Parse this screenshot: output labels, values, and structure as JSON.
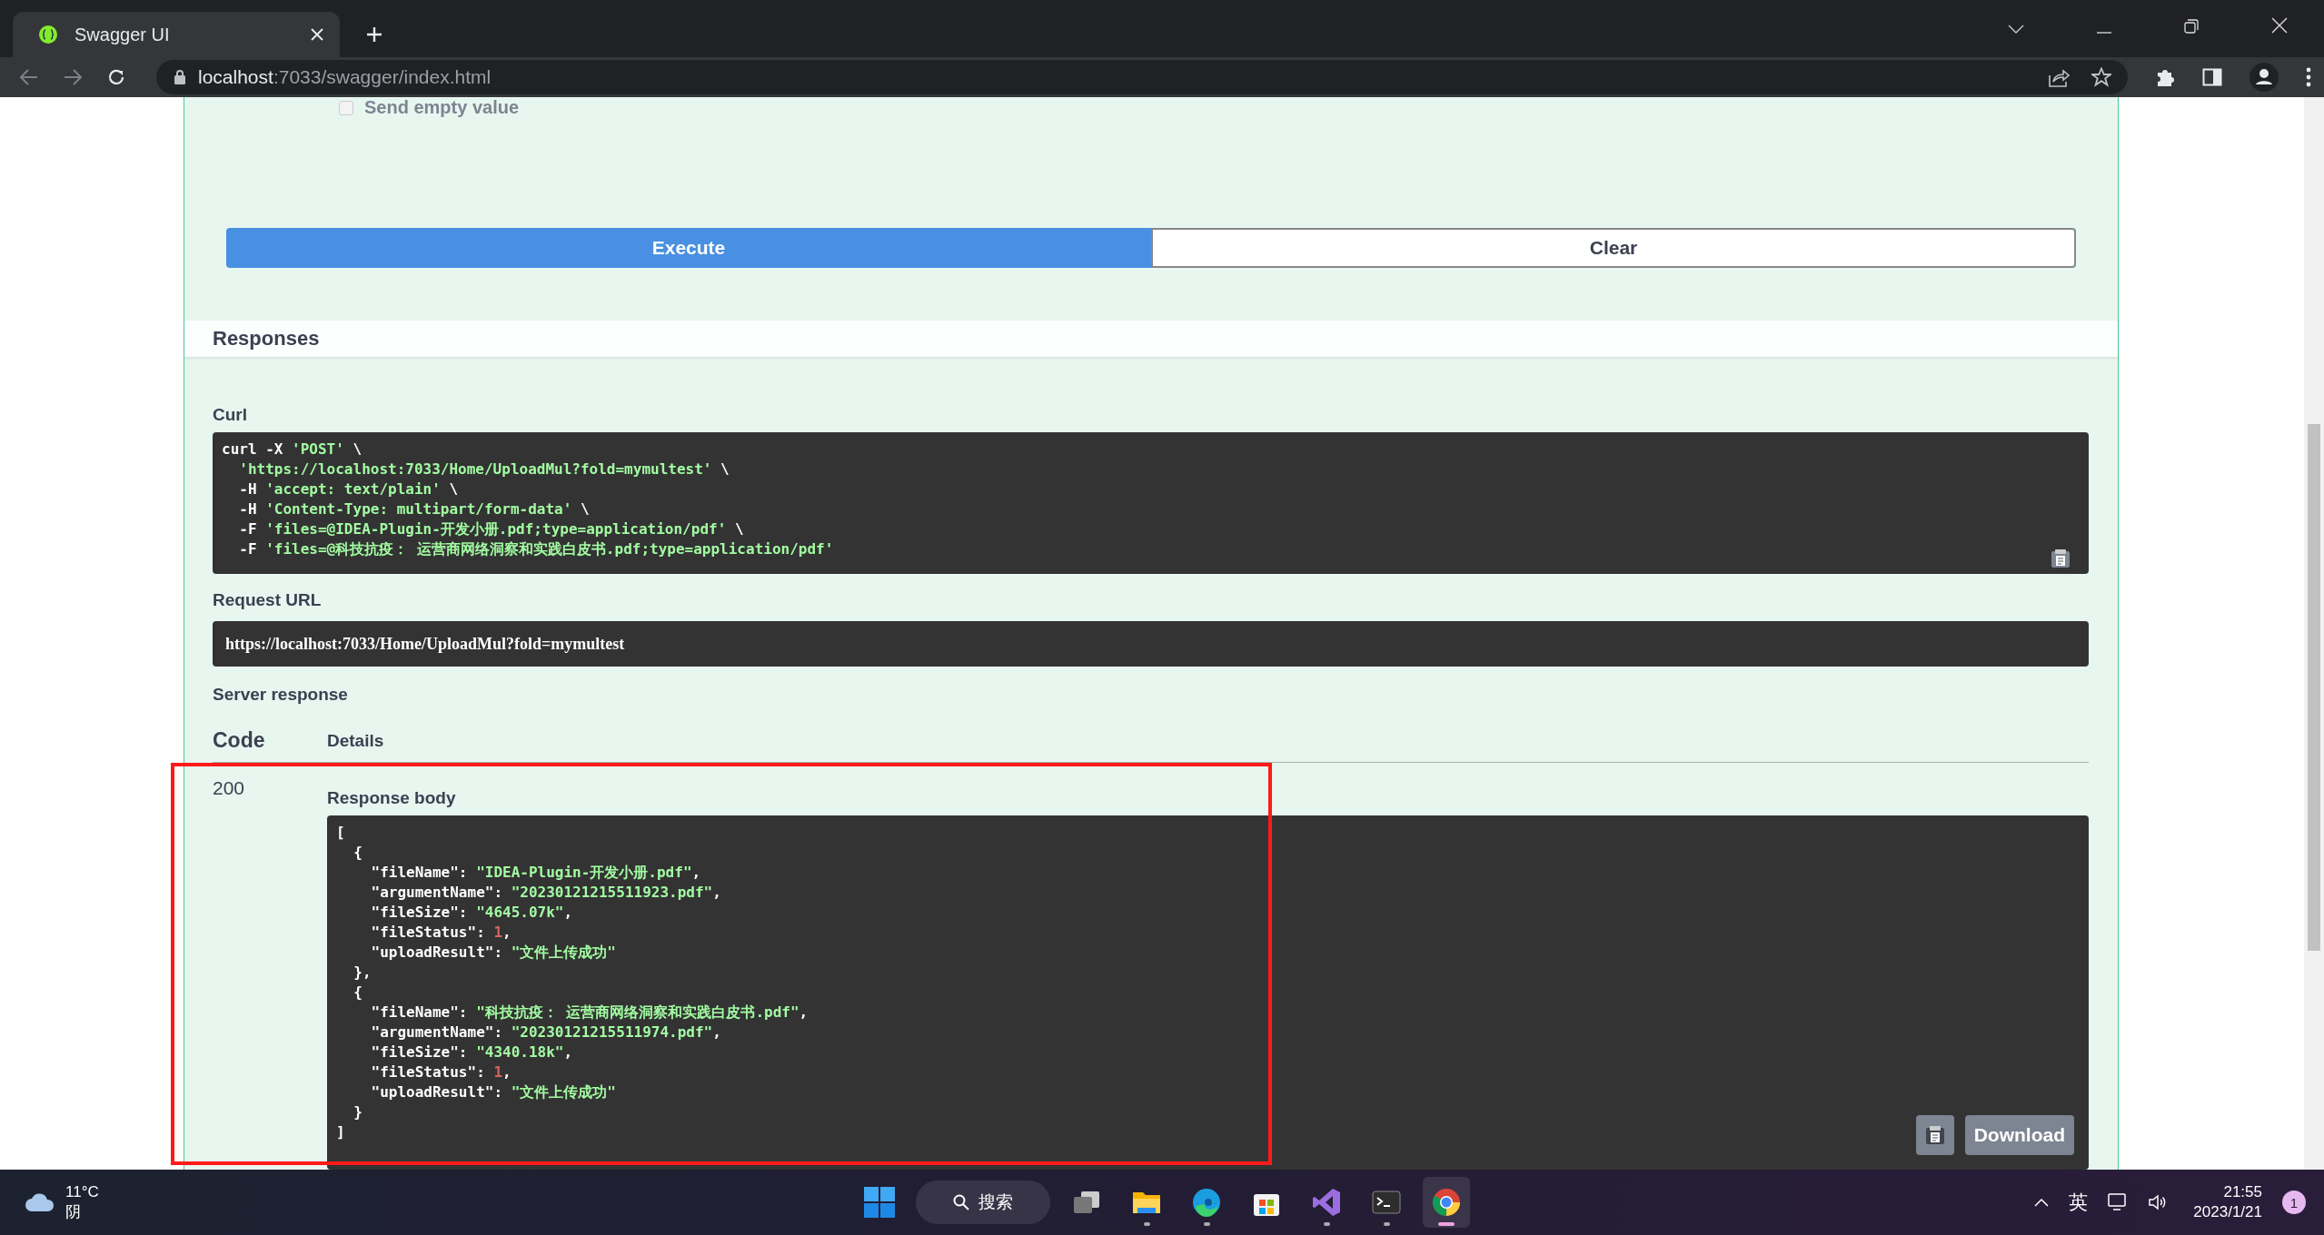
{
  "browser": {
    "tabs": [
      {
        "title": "Swagger UI",
        "selected": true
      }
    ],
    "address": {
      "host": "localhost",
      "path": ":7033/swagger/index.html"
    }
  },
  "page": {
    "parameter": {
      "label": "Send empty value",
      "checked": false
    },
    "buttons": [
      {
        "label": "Execute",
        "kind": "primary"
      },
      {
        "label": "Clear",
        "kind": "secondary"
      }
    ],
    "responses_title": "Responses",
    "curl": {
      "label": "Curl",
      "lines": [
        [
          {
            "kind": "plain",
            "text": "curl -X "
          },
          {
            "kind": "string",
            "text": "'POST'"
          },
          {
            "kind": "plain",
            "text": " \\"
          }
        ],
        [
          {
            "kind": "string",
            "text": "  'https://localhost:7033/Home/UploadMul?fold=mymultest'"
          },
          {
            "kind": "plain",
            "text": " \\"
          }
        ],
        [
          {
            "kind": "plain",
            "text": "  -H "
          },
          {
            "kind": "string",
            "text": "'accept: text/plain'"
          },
          {
            "kind": "plain",
            "text": " \\"
          }
        ],
        [
          {
            "kind": "plain",
            "text": "  -H "
          },
          {
            "kind": "string",
            "text": "'Content-Type: multipart/form-data'"
          },
          {
            "kind": "plain",
            "text": " \\"
          }
        ],
        [
          {
            "kind": "plain",
            "text": "  -F "
          },
          {
            "kind": "string",
            "text": "'files=@IDEA-Plugin-开发小册.pdf;type=application/pdf'"
          },
          {
            "kind": "plain",
            "text": " \\"
          }
        ],
        [
          {
            "kind": "plain",
            "text": "  -F "
          },
          {
            "kind": "string",
            "text": "'files=@科技抗疫： 运营商网络洞察和实践白皮书.pdf;type=application/pdf'"
          }
        ]
      ]
    },
    "request_url": {
      "label": "Request URL",
      "value": "https://localhost:7033/Home/UploadMul?fold=mymultest"
    },
    "server_response": {
      "label": "Server response",
      "columns": [
        "Code",
        "Details"
      ],
      "code": "200",
      "body_label": "Response body",
      "download": "Download",
      "body_lines": [
        [
          {
            "kind": "plain",
            "text": "["
          }
        ],
        [
          {
            "kind": "plain",
            "text": "  {"
          }
        ],
        [
          {
            "kind": "plain",
            "text": "    \"fileName\": "
          },
          {
            "kind": "string",
            "text": "\"IDEA-Plugin-开发小册.pdf\""
          },
          {
            "kind": "plain",
            "text": ","
          }
        ],
        [
          {
            "kind": "plain",
            "text": "    \"argumentName\": "
          },
          {
            "kind": "string",
            "text": "\"20230121215511923.pdf\""
          },
          {
            "kind": "plain",
            "text": ","
          }
        ],
        [
          {
            "kind": "plain",
            "text": "    \"fileSize\": "
          },
          {
            "kind": "string",
            "text": "\"4645.07k\""
          },
          {
            "kind": "plain",
            "text": ","
          }
        ],
        [
          {
            "kind": "plain",
            "text": "    \"fileStatus\": "
          },
          {
            "kind": "number",
            "text": "1"
          },
          {
            "kind": "plain",
            "text": ","
          }
        ],
        [
          {
            "kind": "plain",
            "text": "    \"uploadResult\": "
          },
          {
            "kind": "string",
            "text": "\"文件上传成功\""
          }
        ],
        [
          {
            "kind": "plain",
            "text": "  },"
          }
        ],
        [
          {
            "kind": "plain",
            "text": "  {"
          }
        ],
        [
          {
            "kind": "plain",
            "text": "    \"fileName\": "
          },
          {
            "kind": "string",
            "text": "\"科技抗疫： 运营商网络洞察和实践白皮书.pdf\""
          },
          {
            "kind": "plain",
            "text": ","
          }
        ],
        [
          {
            "kind": "plain",
            "text": "    \"argumentName\": "
          },
          {
            "kind": "string",
            "text": "\"20230121215511974.pdf\""
          },
          {
            "kind": "plain",
            "text": ","
          }
        ],
        [
          {
            "kind": "plain",
            "text": "    \"fileSize\": "
          },
          {
            "kind": "string",
            "text": "\"4340.18k\""
          },
          {
            "kind": "plain",
            "text": ","
          }
        ],
        [
          {
            "kind": "plain",
            "text": "    \"fileStatus\": "
          },
          {
            "kind": "number",
            "text": "1"
          },
          {
            "kind": "plain",
            "text": ","
          }
        ],
        [
          {
            "kind": "plain",
            "text": "    \"uploadResult\": "
          },
          {
            "kind": "string",
            "text": "\"文件上传成功\""
          }
        ],
        [
          {
            "kind": "plain",
            "text": "  }"
          }
        ],
        [
          {
            "kind": "plain",
            "text": "]"
          }
        ]
      ]
    }
  },
  "taskbar": {
    "weather": {
      "temperature": "11°C",
      "condition": "阴"
    },
    "apps": [
      {
        "kind": "start",
        "running": false,
        "selected": false
      },
      {
        "kind": "search",
        "label": "搜索",
        "running": false,
        "selected": false
      },
      {
        "kind": "taskview",
        "running": false,
        "selected": false
      },
      {
        "kind": "explorer",
        "running": true,
        "selected": false
      },
      {
        "kind": "edge",
        "running": true,
        "selected": false
      },
      {
        "kind": "store",
        "running": false,
        "selected": false
      },
      {
        "kind": "vs",
        "running": true,
        "selected": false
      },
      {
        "kind": "terminal",
        "running": true,
        "selected": false
      },
      {
        "kind": "chrome",
        "running": true,
        "selected": true
      }
    ],
    "ime": "英",
    "time": "21:55",
    "date": "2023/1/21",
    "notifications": "1"
  }
}
